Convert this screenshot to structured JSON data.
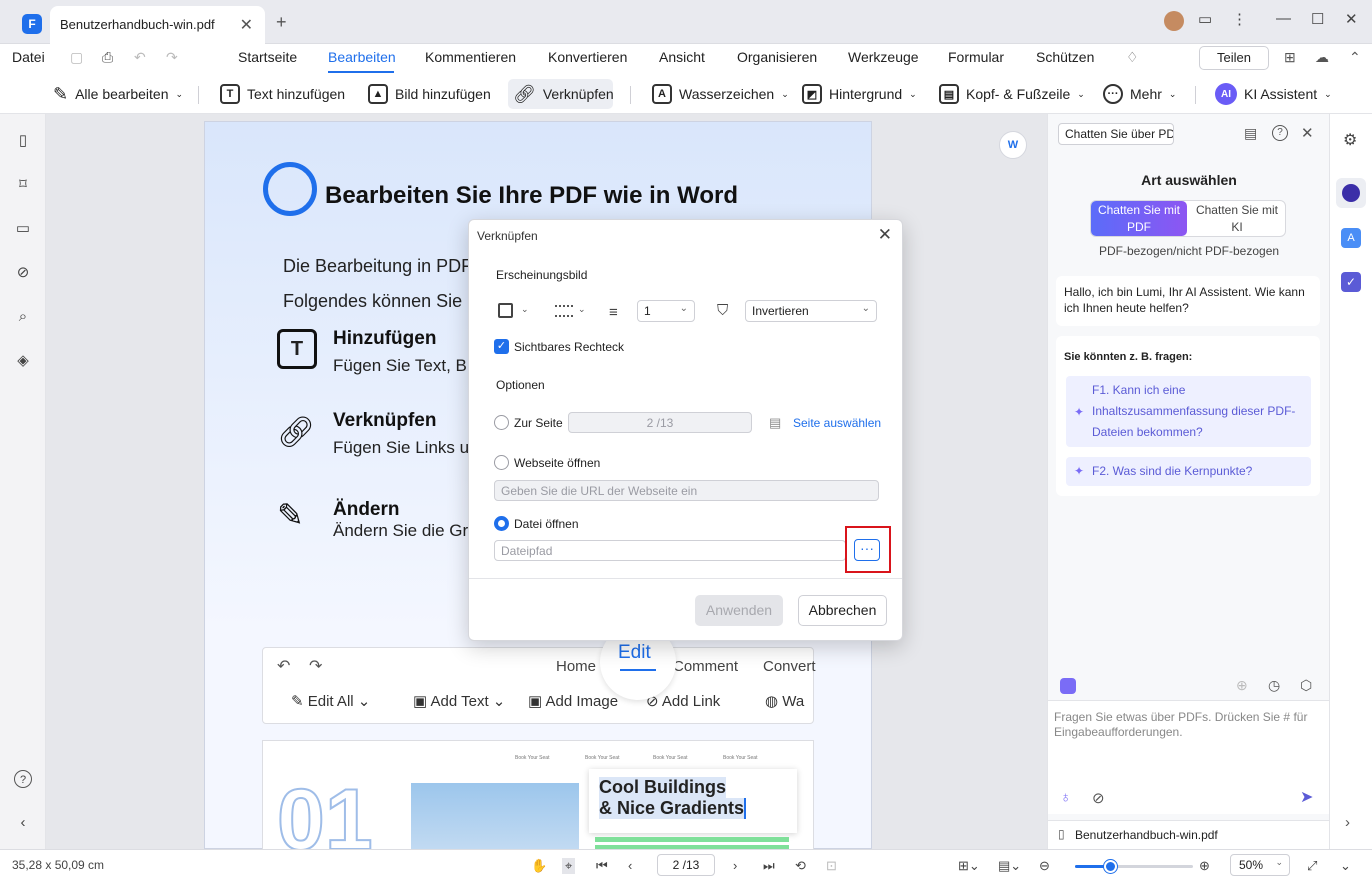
{
  "titlebar": {
    "tab_title": "Benutzerhandbuch-win.pdf",
    "close": "✕",
    "new_tab": "+"
  },
  "menu": {
    "file": "Datei",
    "items": [
      "Startseite",
      "Bearbeiten",
      "Kommentieren",
      "Konvertieren",
      "Ansicht",
      "Organisieren",
      "Werkzeuge",
      "Formular",
      "Schützen"
    ],
    "active": "Bearbeiten",
    "share": "Teilen"
  },
  "toolbar": {
    "edit_all": "Alle bearbeiten",
    "add_text": "Text hinzufügen",
    "add_image": "Bild hinzufügen",
    "link": "Verknüpfen",
    "watermark": "Wasserzeichen",
    "background": "Hintergrund",
    "header_footer": "Kopf- & Fußzeile",
    "more": "Mehr",
    "ai_assistant": "KI Assistent",
    "ai_badge": "AI"
  },
  "page": {
    "title": "Bearbeiten Sie Ihre PDF wie in Word",
    "line1": "Die Bearbeitung in PDF",
    "line2": "Folgendes können Sie",
    "feature1_title": "Hinzufügen",
    "feature1_text": "Fügen Sie Text, Bi",
    "feature2_title": "Verknüpfen",
    "feature2_text": "Fügen Sie Links u",
    "feature3_title": "Ändern",
    "feature3_text": "Ändern Sie die Gr",
    "shot_tabs": [
      "Home",
      "Edit",
      "Comment",
      "Convert"
    ],
    "shot_tools": [
      "Edit All",
      "Add Text",
      "Add Image",
      "Add Link",
      "Wa"
    ],
    "cool_title_1": "Cool Buildings",
    "cool_title_2": "& Nice Gradients",
    "book_seat": "Book Your Seat",
    "big_number": "01"
  },
  "dialog": {
    "title": "Verknüpfen",
    "appearance": "Erscheinungsbild",
    "line_width": "1",
    "highlight": "Invertieren",
    "visible_rect": "Sichtbares Rechteck",
    "options": "Optionen",
    "to_page": "Zur Seite",
    "page_value": "2 /13",
    "select_page": "Seite auswählen",
    "open_web": "Webseite öffnen",
    "url_placeholder": "Geben Sie die URL der Webseite ein",
    "open_file": "Datei öffnen",
    "file_placeholder": "Dateipfad",
    "browse": "···",
    "apply": "Anwenden",
    "cancel": "Abbrechen"
  },
  "chat": {
    "selector": "Chatten Sie über PDF",
    "choose_type": "Art auswählen",
    "mode_pdf": "Chatten Sie mit PDF",
    "mode_ai": "Chatten Sie mit KI",
    "mode_desc": "PDF-bezogen/nicht PDF-bezogen",
    "greeting": "Hallo, ich bin Lumi, Ihr AI Assistent. Wie kann ich Ihnen heute helfen?",
    "suggest_heading": "Sie könnten z. B. fragen:",
    "q1": "F1. Kann ich eine Inhaltszusammenfassung dieser PDF-Dateien bekommen?",
    "q2": "F2. Was sind die Kernpunkte?",
    "input_placeholder": "Fragen Sie etwas über PDFs. Drücken Sie # für Eingabeaufforderungen.",
    "file_name": "Benutzerhandbuch-win.pdf"
  },
  "status": {
    "dimensions": "35,28 x 50,09 cm",
    "page": "2 /13",
    "zoom": "50%",
    "zoom_level": 0.3
  }
}
